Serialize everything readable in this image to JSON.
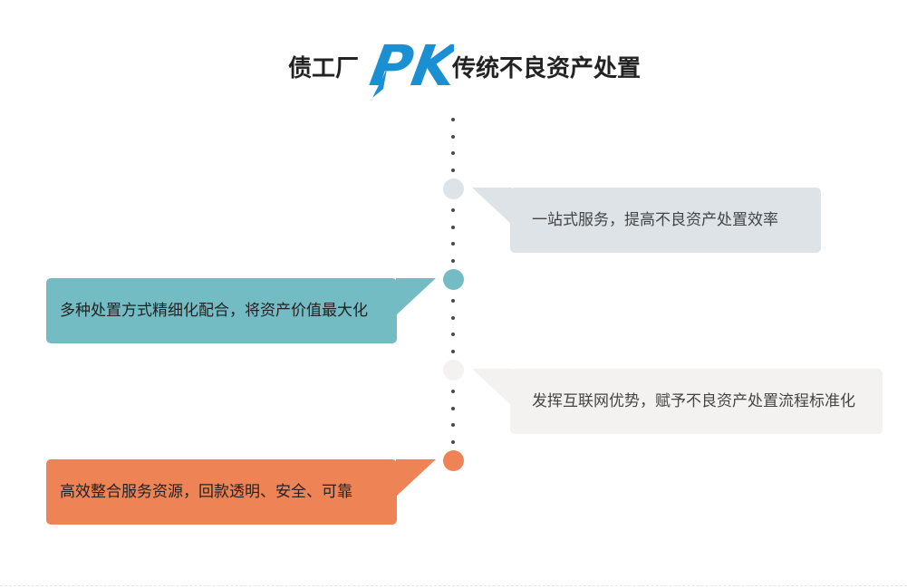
{
  "header": {
    "title_left": "债工厂",
    "logo_text": "PK",
    "title_right": "传统不良资产处置"
  },
  "colors": {
    "logo_blue": "#1a8fd1",
    "teal": "#73bcc4",
    "light_gray": "#dde3e6",
    "pale_gray": "#f4f1f1",
    "orange": "#ee8356",
    "dots": "#4a4a4a",
    "text_dark": "#444444",
    "text_light": "#ffffff"
  },
  "items": [
    {
      "text": "一站式服务，提高不良资产处置效率"
    },
    {
      "text": "多种处置方式精细化配合，将资产价值最大化"
    },
    {
      "text": "发挥互联网优势，赋予不良资产处置流程标准化"
    },
    {
      "text": "高效整合服务资源，回款透明、安全、可靠"
    }
  ]
}
